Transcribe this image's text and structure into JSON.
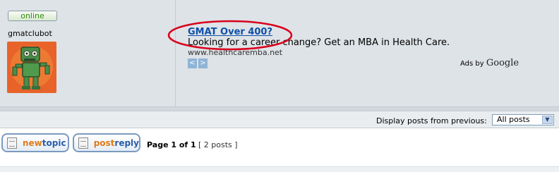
{
  "author": {
    "status": "online",
    "username": "gmatclubot"
  },
  "ad": {
    "title": "GMAT Over 400?",
    "description": "Looking for a career change? Get an MBA in Health Care.",
    "url": "www.healthcaremba.net",
    "nav_prev": "<",
    "nav_next": ">",
    "ads_by_label": "Ads by",
    "ads_by_brand": "Google"
  },
  "display": {
    "label": "Display posts from previous:",
    "selected": "All posts"
  },
  "toolbar": {
    "newtopic_prefix": "new",
    "newtopic_suffix": "topic",
    "postreply_prefix": "post",
    "postreply_suffix": "reply",
    "pagination": "Page 1 of 1",
    "post_count": "[ 2 posts ]"
  },
  "colors": {
    "link": "#0f4fa8",
    "online": "#2e8b10",
    "highlight_ellipse": "#d9001b",
    "button_accent": "#e07a18"
  }
}
